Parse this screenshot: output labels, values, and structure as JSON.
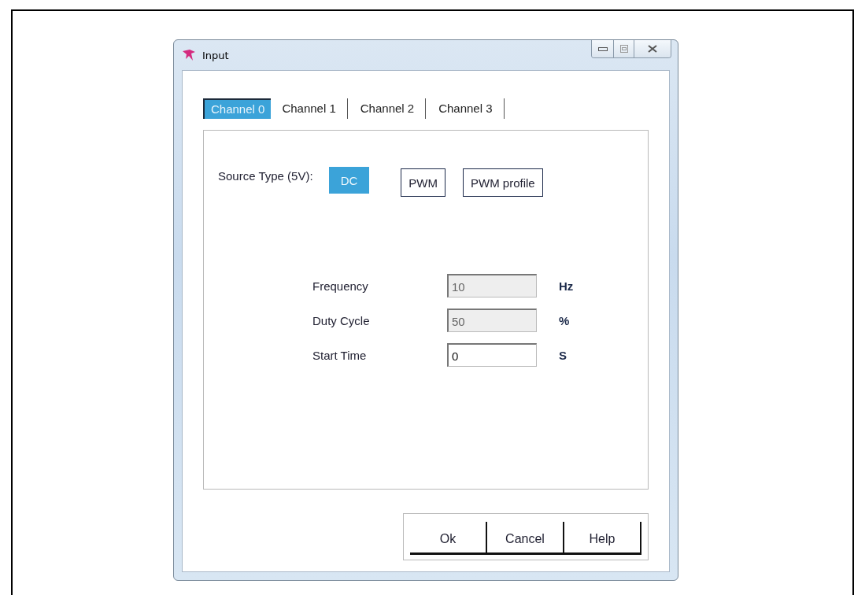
{
  "window": {
    "title": "Input"
  },
  "tabs": [
    {
      "label": "Channel 0",
      "selected": true
    },
    {
      "label": "Channel 1",
      "selected": false
    },
    {
      "label": "Channel 2",
      "selected": false
    },
    {
      "label": "Channel 3",
      "selected": false
    }
  ],
  "source_type": {
    "label": "Source Type (5V):",
    "options": [
      {
        "label": "DC",
        "selected": true
      },
      {
        "label": "PWM",
        "selected": false
      },
      {
        "label": "PWM profile",
        "selected": false
      }
    ]
  },
  "fields": [
    {
      "label": "Frequency",
      "value": "10",
      "unit": "Hz",
      "disabled": true
    },
    {
      "label": "Duty Cycle",
      "value": "50",
      "unit": "%",
      "disabled": true
    },
    {
      "label": "Start Time",
      "value": "0",
      "unit": "S",
      "disabled": false
    }
  ],
  "buttons": [
    "Ok",
    "Cancel",
    "Help"
  ]
}
